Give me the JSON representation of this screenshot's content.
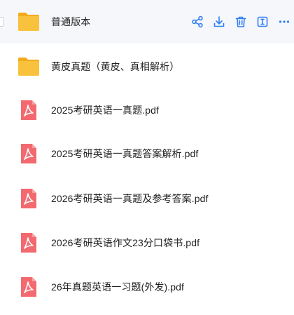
{
  "files": [
    {
      "name": "普通版本",
      "type": "folder",
      "icon": "folder-icon",
      "hovered": true
    },
    {
      "name": "黄皮真题（黄皮、真相解析）",
      "type": "folder",
      "icon": "folder-icon",
      "hovered": false
    },
    {
      "name": "2025考研英语一真题.pdf",
      "type": "pdf",
      "icon": "pdf-icon",
      "hovered": false
    },
    {
      "name": "2025考研英语一真题答案解析.pdf",
      "type": "pdf",
      "icon": "pdf-icon",
      "hovered": false
    },
    {
      "name": "2026考研英语一真题及参考答案.pdf",
      "type": "pdf",
      "icon": "pdf-icon",
      "hovered": false
    },
    {
      "name": "2026考研英语作文23分口袋书.pdf",
      "type": "pdf",
      "icon": "pdf-icon",
      "hovered": false
    },
    {
      "name": "26年真题英语一习题(外发).pdf",
      "type": "pdf",
      "icon": "pdf-icon",
      "hovered": false
    }
  ],
  "row_actions": [
    {
      "name": "share-icon"
    },
    {
      "name": "download-icon"
    },
    {
      "name": "trash-icon"
    },
    {
      "name": "rename-icon"
    },
    {
      "name": "more-icon"
    }
  ],
  "colors": {
    "accent": "#2f7cf6",
    "folder": "#f9c23c",
    "folder_dark": "#f2ac1a",
    "pdf": "#f26a6f",
    "hover_bg": "#f5f7fb"
  }
}
